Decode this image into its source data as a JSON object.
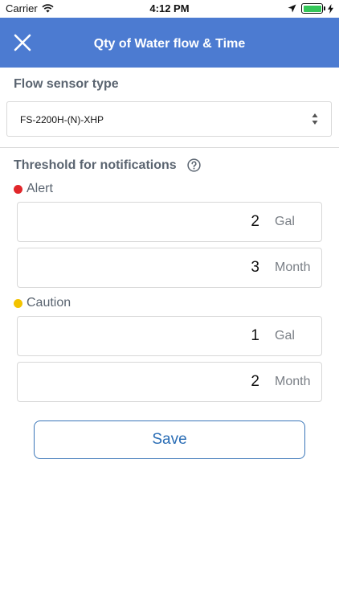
{
  "status_bar": {
    "carrier": "Carrier",
    "time": "4:12 PM",
    "icons": [
      "wifi-icon",
      "location-arrow-icon",
      "battery-icon",
      "charging-bolt-icon"
    ],
    "battery_color": "#34c759"
  },
  "nav": {
    "title": "Qty of Water flow & Time",
    "close_icon": "close-icon",
    "background_color": "#4c7bd1"
  },
  "flow_sensor": {
    "label": "Flow sensor type",
    "selected_value": "FS-2200H-(N)-XHP"
  },
  "threshold": {
    "label": "Threshold for notifications",
    "help_icon": "help-circle-icon",
    "alert": {
      "label": "Alert",
      "color": "#e1262a",
      "quantity": {
        "value": "2",
        "unit": "Gal"
      },
      "period": {
        "value": "3",
        "unit": "Month"
      }
    },
    "caution": {
      "label": "Caution",
      "color": "#f3c300",
      "quantity": {
        "value": "1",
        "unit": "Gal"
      },
      "period": {
        "value": "2",
        "unit": "Month"
      }
    }
  },
  "actions": {
    "save_label": "Save"
  }
}
